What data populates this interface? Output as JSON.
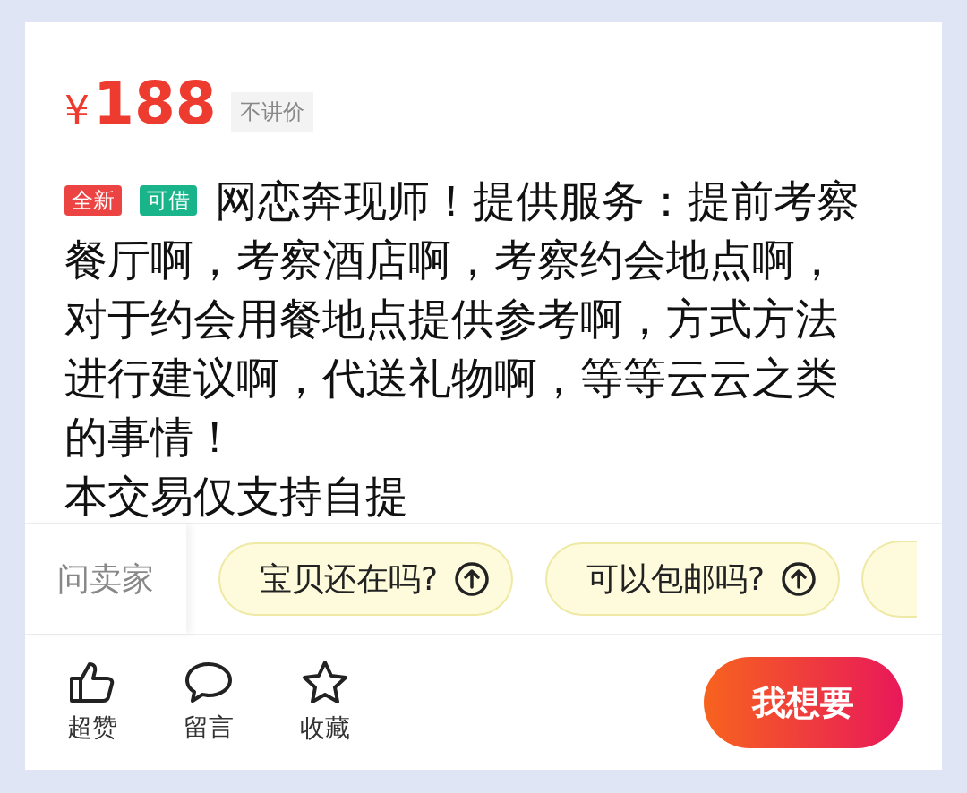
{
  "price": {
    "currency": "¥",
    "amount": "188",
    "note": "不讲价"
  },
  "tags": [
    {
      "label": "全新",
      "color": "#ec4343"
    },
    {
      "label": "可借",
      "color": "#19b48a"
    }
  ],
  "description_lines": [
    "网恋奔现师！提供服务：提前考察",
    "餐厅啊，考察酒店啊，考察约会地点啊，",
    "对于约会用餐地点提供参考啊，方式方法",
    "进行建议啊，代送礼物啊，等等云云之类",
    "的事情！",
    "本交易仅支持自提"
  ],
  "ask_seller": {
    "label": "问卖家",
    "questions": [
      "宝贝还在吗?",
      "可以包邮吗?"
    ]
  },
  "actions": [
    {
      "kind": "like",
      "label": "超赞"
    },
    {
      "kind": "comment",
      "label": "留言"
    },
    {
      "kind": "favorite",
      "label": "收藏"
    }
  ],
  "want_button": "我想要"
}
